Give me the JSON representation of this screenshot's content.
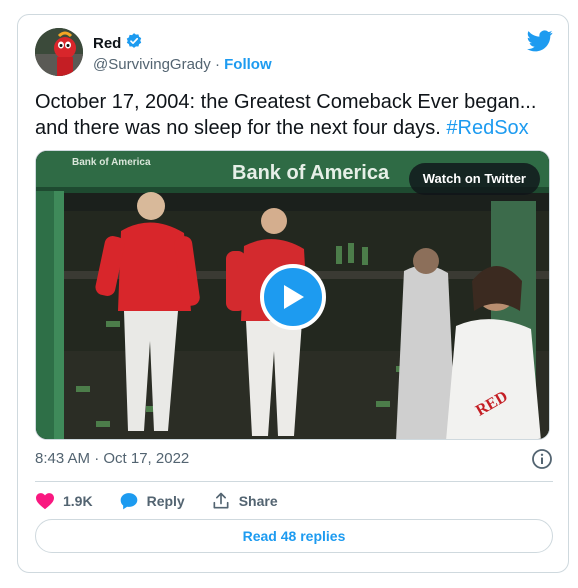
{
  "author": {
    "display_name": "Red",
    "handle": "@SurvivingGrady",
    "separator": " · ",
    "follow_label": "Follow",
    "verified": true
  },
  "tweet": {
    "text": "October 17, 2004: the Greatest Comeback Ever began... and there was no sleep for the next four days.",
    "hashtag": "#RedSox"
  },
  "media": {
    "watch_label": "Watch on Twitter",
    "banner_text": "Bank of America",
    "banner_text_small": "Bank of America"
  },
  "meta": {
    "timestamp": "8:43 AM · Oct 17, 2022"
  },
  "actions": {
    "like_count": "1.9K",
    "reply_label": "Reply",
    "share_label": "Share"
  },
  "read_replies_label": "Read 48 replies",
  "colors": {
    "accent": "#1d9bf0",
    "like": "#f91880",
    "text": "#0f1419",
    "muted": "#536471"
  }
}
